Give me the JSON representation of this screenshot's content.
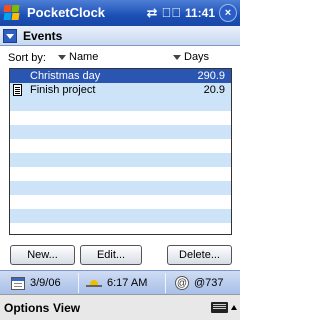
{
  "titlebar": {
    "app_title": "PocketClock",
    "time": "11:41",
    "close_label": "×",
    "icons": [
      "windows-start-icon",
      "connectivity-icon",
      "volume-icon",
      "close-icon"
    ]
  },
  "events_header": {
    "label": "Events"
  },
  "sort": {
    "label": "Sort by:",
    "col_name": "Name",
    "col_days": "Days"
  },
  "events": [
    {
      "name": "Christmas day",
      "days": "290.9",
      "selected": true,
      "icon": "none"
    },
    {
      "name": "Finish project",
      "days": "20.9",
      "selected": false,
      "icon": "document-icon"
    }
  ],
  "buttons": {
    "new": "New...",
    "edit": "Edit...",
    "delete": "Delete..."
  },
  "today_bar": {
    "date": "3/9/06",
    "sunrise": "6:17 AM",
    "beat": "@737"
  },
  "menu": {
    "options": "Options",
    "view": "View"
  },
  "colors": {
    "title_bar": "#1c4fb5",
    "selection": "#2a55b0",
    "stripe": "#cde3f8"
  }
}
